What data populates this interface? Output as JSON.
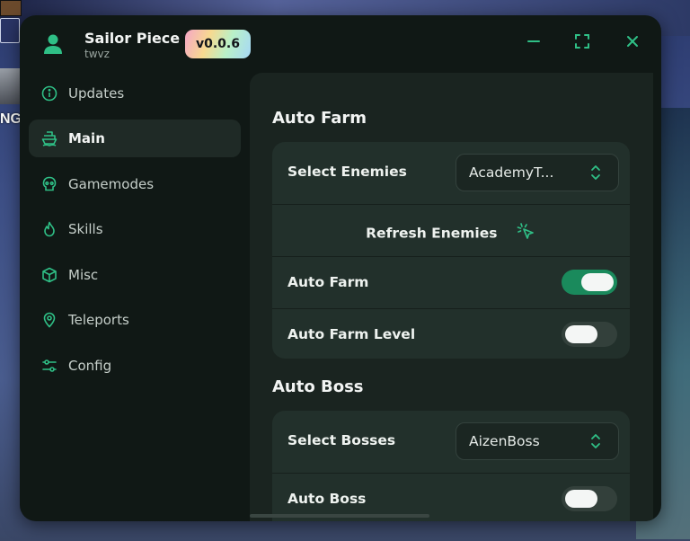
{
  "background": {
    "side_text": "NG"
  },
  "header": {
    "title": "Sailor Piece",
    "subtitle": "twvz",
    "version": "v0.0.6"
  },
  "sidebar": {
    "items": [
      {
        "label": "Updates",
        "icon": "info-icon"
      },
      {
        "label": "Main",
        "icon": "ship-icon",
        "active": true
      },
      {
        "label": "Gamemodes",
        "icon": "skull-icon"
      },
      {
        "label": "Skills",
        "icon": "flame-icon"
      },
      {
        "label": "Misc",
        "icon": "box-icon"
      },
      {
        "label": "Teleports",
        "icon": "location-pin-icon"
      },
      {
        "label": "Config",
        "icon": "sliders-icon"
      }
    ]
  },
  "main": {
    "auto_farm": {
      "title": "Auto Farm",
      "select_enemies_label": "Select Enemies",
      "select_enemies_value": "AcademyT...",
      "refresh_label": "Refresh Enemies",
      "auto_farm_label": "Auto Farm",
      "auto_farm_on": true,
      "auto_farm_level_label": "Auto Farm Level",
      "auto_farm_level_on": false
    },
    "auto_boss": {
      "title": "Auto Boss",
      "select_bosses_label": "Select Bosses",
      "select_bosses_value": "AizenBoss",
      "auto_boss_label": "Auto Boss",
      "auto_boss_on": false
    }
  },
  "colors": {
    "accent": "#1a8a5c",
    "window_bg": "#101815",
    "panel_bg": "#1a2420",
    "group_bg": "#22302b"
  }
}
